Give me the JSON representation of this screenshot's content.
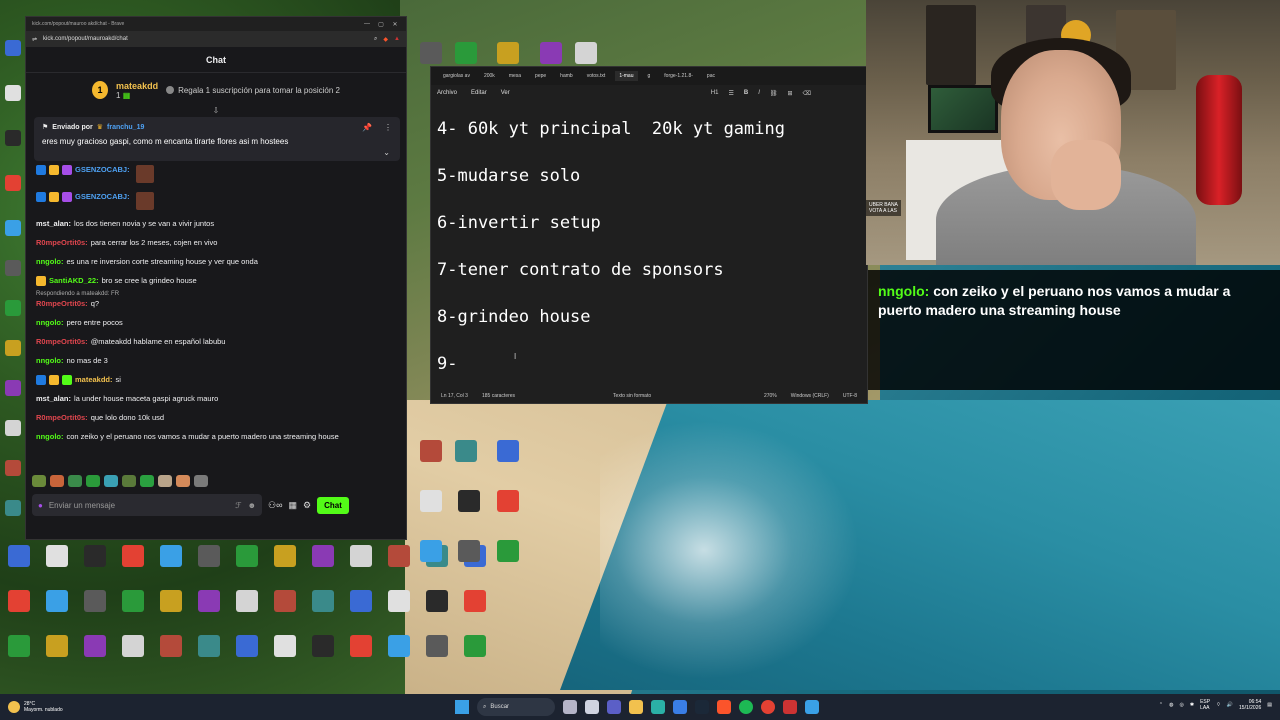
{
  "browser": {
    "title": "kick.com/popout/mauroo akd/chat - Brave",
    "url": "kick.com/popout/mauroakd/chat"
  },
  "chat": {
    "header": "Chat",
    "subscription": {
      "user": "mateakdd",
      "badge_number": "1",
      "count": "1",
      "text": "Regala 1 suscripción para tomar la posición 2"
    },
    "pinned": {
      "prefix": "Enviado por",
      "user": "franchu_19",
      "message": "eres muy gracioso gaspi, como m encanta tirarte flores asi m hostees"
    },
    "messages": [
      {
        "user": "GSENZOCABJ:",
        "color": "#4ea1f3",
        "text": "",
        "badges": [
          "#1f7ae0",
          "#f5b82e",
          "#a64ee8"
        ]
      },
      {
        "user": "GSENZOCABJ:",
        "color": "#4ea1f3",
        "text": "",
        "badges": [
          "#1f7ae0",
          "#f5b82e",
          "#a64ee8"
        ]
      },
      {
        "user": "mst_alan:",
        "color": "#efeff1",
        "text": "los dos tienen novia y se van a vivir juntos",
        "badges": []
      },
      {
        "user": "R0mpeOrtit0s:",
        "color": "#e0464e",
        "text": "para cerrar los 2 meses, cojen en vivo",
        "badges": []
      },
      {
        "user": "nngolo:",
        "color": "#53fc18",
        "text": "es una re inversion corte streaming house y ver que onda",
        "badges": []
      },
      {
        "user": "SantiAKD_22:",
        "color": "#53fc18",
        "text": "bro se cree la grindeo house",
        "badges": [
          "#f5b82e"
        ]
      },
      {
        "user": "R0mpeOrtit0s:",
        "color": "#e0464e",
        "text": "q?",
        "badges": [],
        "reply": "Respondiendo a mateakdd: FR"
      },
      {
        "user": "nngolo:",
        "color": "#53fc18",
        "text": "pero entre pocos",
        "badges": []
      },
      {
        "user": "R0mpeOrtit0s:",
        "color": "#e0464e",
        "text": "@mateakdd hablame en español labubu",
        "badges": []
      },
      {
        "user": "nngolo:",
        "color": "#53fc18",
        "text": "no mas de 3",
        "badges": []
      },
      {
        "user": "mateakdd:",
        "color": "#f2c14e",
        "text": "si",
        "badges": [
          "#1f7ae0",
          "#f5b82e",
          "#53fc18"
        ]
      },
      {
        "user": "mst_alan:",
        "color": "#efeff1",
        "text": "la under house maceta gaspi agruck mauro",
        "badges": []
      },
      {
        "user": "R0mpeOrtit0s:",
        "color": "#e0464e",
        "text": "que lolo dono 10k usd",
        "badges": []
      },
      {
        "user": "nngolo:",
        "color": "#53fc18",
        "text": "con zeiko y el peruano nos vamos a mudar a puerto madero una streaming house",
        "badges": []
      }
    ],
    "input_placeholder": "Enviar un mensaje",
    "send_label": "Chat"
  },
  "notepad": {
    "tabs": [
      "gargiolas av",
      "200k",
      "mesa",
      "pepe",
      "hamb",
      "votos.txt",
      "1-mau",
      "g",
      "forge-1.21.8-",
      "pac"
    ],
    "menu": [
      "Archivo",
      "Editar",
      "Ver"
    ],
    "toolbar": {
      "heading": "H1",
      "bold": "B",
      "italic": "I"
    },
    "lines": [
      "4- 60k yt principal  20k yt gaming",
      "5-mudarse solo",
      "6-invertir setup",
      "7-tener contrato de sponsors",
      "8-grindeo house",
      "9-"
    ],
    "status": {
      "position": "Ln 17, Col 3",
      "chars": "185 caracteres",
      "format": "Texto sin formato",
      "zoom": "270%",
      "line_ending": "Windows (CRLF)",
      "encoding": "UTF-8"
    }
  },
  "webcam_overlay": {
    "line1": "UBER BANA",
    "line2": "VOTA A LAS"
  },
  "overlay_message": {
    "user": "nngolo:",
    "text": "con zeiko y el peruano nos vamos a mudar a puerto madero una streaming house"
  },
  "taskbar": {
    "weather_temp": "28°C",
    "weather_desc": "Mayorm. nublado",
    "search": "Buscar",
    "lang": "ESP",
    "lang2": "LAA",
    "time": "06:54",
    "date": "15/1/2026"
  }
}
